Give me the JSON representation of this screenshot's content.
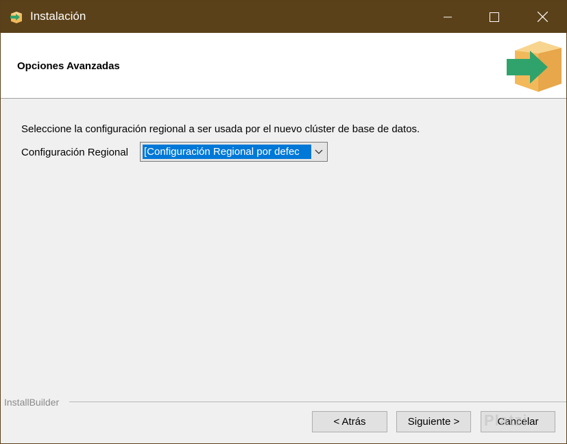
{
  "window": {
    "title": "Instalación",
    "icon": "installer-box-icon",
    "controls": {
      "minimize": "minimize-icon",
      "maximize": "maximize-icon",
      "close": "close-icon"
    }
  },
  "header": {
    "title": "Opciones Avanzadas",
    "logo": "installer-box-arrow-logo"
  },
  "content": {
    "description": "Seleccione la configuración regional a ser usada por el nuevo clúster de base de datos.",
    "locale_label": "Configuración Regional",
    "locale_value": "[Configuración Regional por defec"
  },
  "footer": {
    "brand": "InstallBuilder",
    "buttons": {
      "back": "< Atrás",
      "next": "Siguiente >",
      "cancel": "Cancelar"
    }
  },
  "watermark": "Platzi",
  "colors": {
    "titlebar": "#5b4119",
    "selection": "#0078d7",
    "logo_box": "#f2b95b",
    "logo_arrow": "#2fa36b"
  }
}
